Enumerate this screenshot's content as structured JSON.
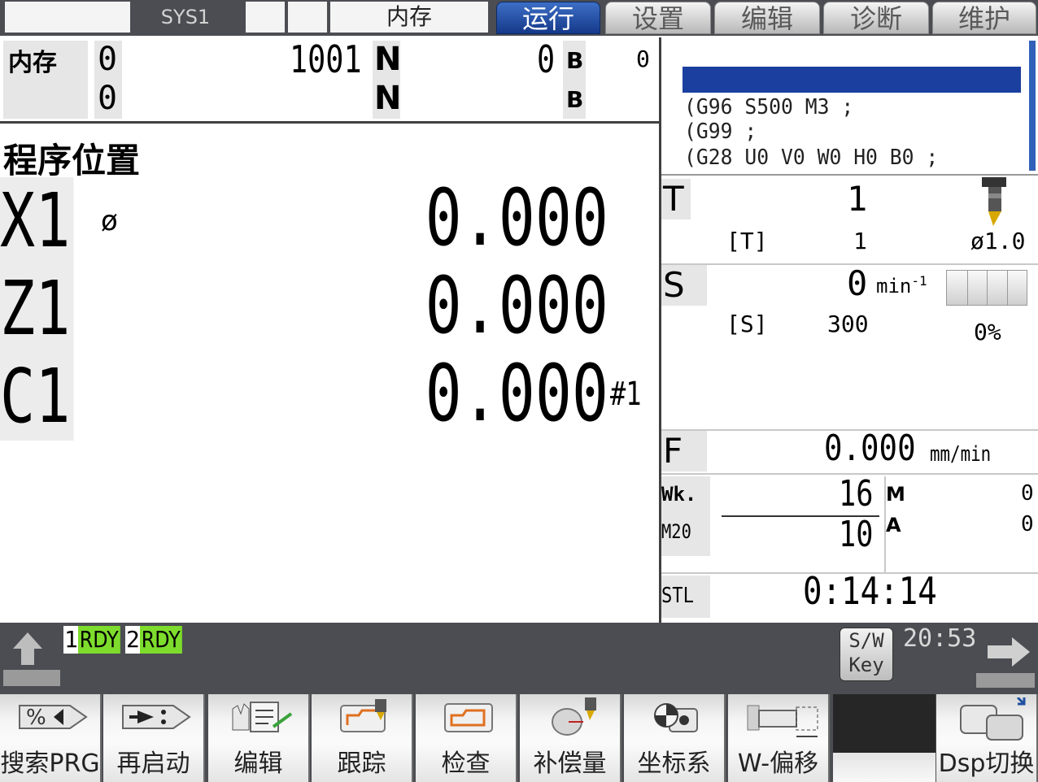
{
  "topbar": {
    "sys_label": "SYS1",
    "memory_label": "内存",
    "tabs": [
      {
        "label": "运行",
        "active": true
      },
      {
        "label": "设置",
        "active": false
      },
      {
        "label": "编辑",
        "active": false
      },
      {
        "label": "诊断",
        "active": false
      },
      {
        "label": "维护",
        "active": false
      }
    ]
  },
  "program_header": {
    "mode_label": "内存",
    "row1": {
      "o_value": "0",
      "program_no": "1001",
      "n_label": "N",
      "n_value": "0",
      "b_label": "B",
      "extra": "0"
    },
    "row2": {
      "o_value": "0",
      "n_label": "N",
      "b_label": "B"
    }
  },
  "position": {
    "title": "程序位置",
    "diameter_symbol": "ø",
    "axes": [
      {
        "name": "X1",
        "value": "0.000"
      },
      {
        "name": "Z1",
        "value": "0.000"
      },
      {
        "name": "C1",
        "value": "0.000"
      }
    ],
    "spindle_marker": "#1"
  },
  "program_view": {
    "lines": [
      "(G96 S500 M3 ;",
      "(G99 ;",
      "(G28 U0 V0 W0 H0 B0 ;"
    ]
  },
  "tool": {
    "label": "T",
    "value": "1",
    "bracket_label": "[T]",
    "bracket_value": "1",
    "diameter": "ø1.0"
  },
  "spindle": {
    "label": "S",
    "value": "0",
    "unit": "min",
    "unit_exp": "-1",
    "bracket_label": "[S]",
    "bracket_value": "300",
    "load": "0%",
    "load_fraction": 0
  },
  "feed": {
    "label": "F",
    "value": "0.000",
    "unit": "mm/min"
  },
  "work": {
    "wk_label": "Wk.",
    "wk_value": "16",
    "m20_label": "M20",
    "m20_value": "10",
    "m_label": "M",
    "m_value": "0",
    "a_label": "A",
    "a_value": "0"
  },
  "stl": {
    "label": "STL",
    "value": "0:14:14"
  },
  "status": {
    "rdy1_num": "1",
    "rdy1_text": "RDY",
    "rdy2_num": "2",
    "rdy2_text": "RDY",
    "sw_key_line1": "S/W",
    "sw_key_line2": "Key",
    "time": "20:53"
  },
  "softkeys": [
    {
      "label": "搜索PRG",
      "icon": "search-program-icon"
    },
    {
      "label": "再启动",
      "icon": "restart-icon"
    },
    {
      "label": "编辑",
      "icon": "edit-hand-icon"
    },
    {
      "label": "跟踪",
      "icon": "trace-icon"
    },
    {
      "label": "检查",
      "icon": "check-icon"
    },
    {
      "label": "补偿量",
      "icon": "compensation-icon"
    },
    {
      "label": "坐标系",
      "icon": "coordinate-icon"
    },
    {
      "label": "W-偏移",
      "icon": "work-offset-icon"
    },
    {
      "label": "",
      "icon": ""
    },
    {
      "label": "Dsp切换",
      "icon": "display-switch-icon"
    }
  ],
  "colors": {
    "active_tab": "#1f4da0",
    "rdy_green": "#7ddc2c",
    "program_highlight": "#1a3f9e",
    "panel_dark": "#4b4d52"
  }
}
